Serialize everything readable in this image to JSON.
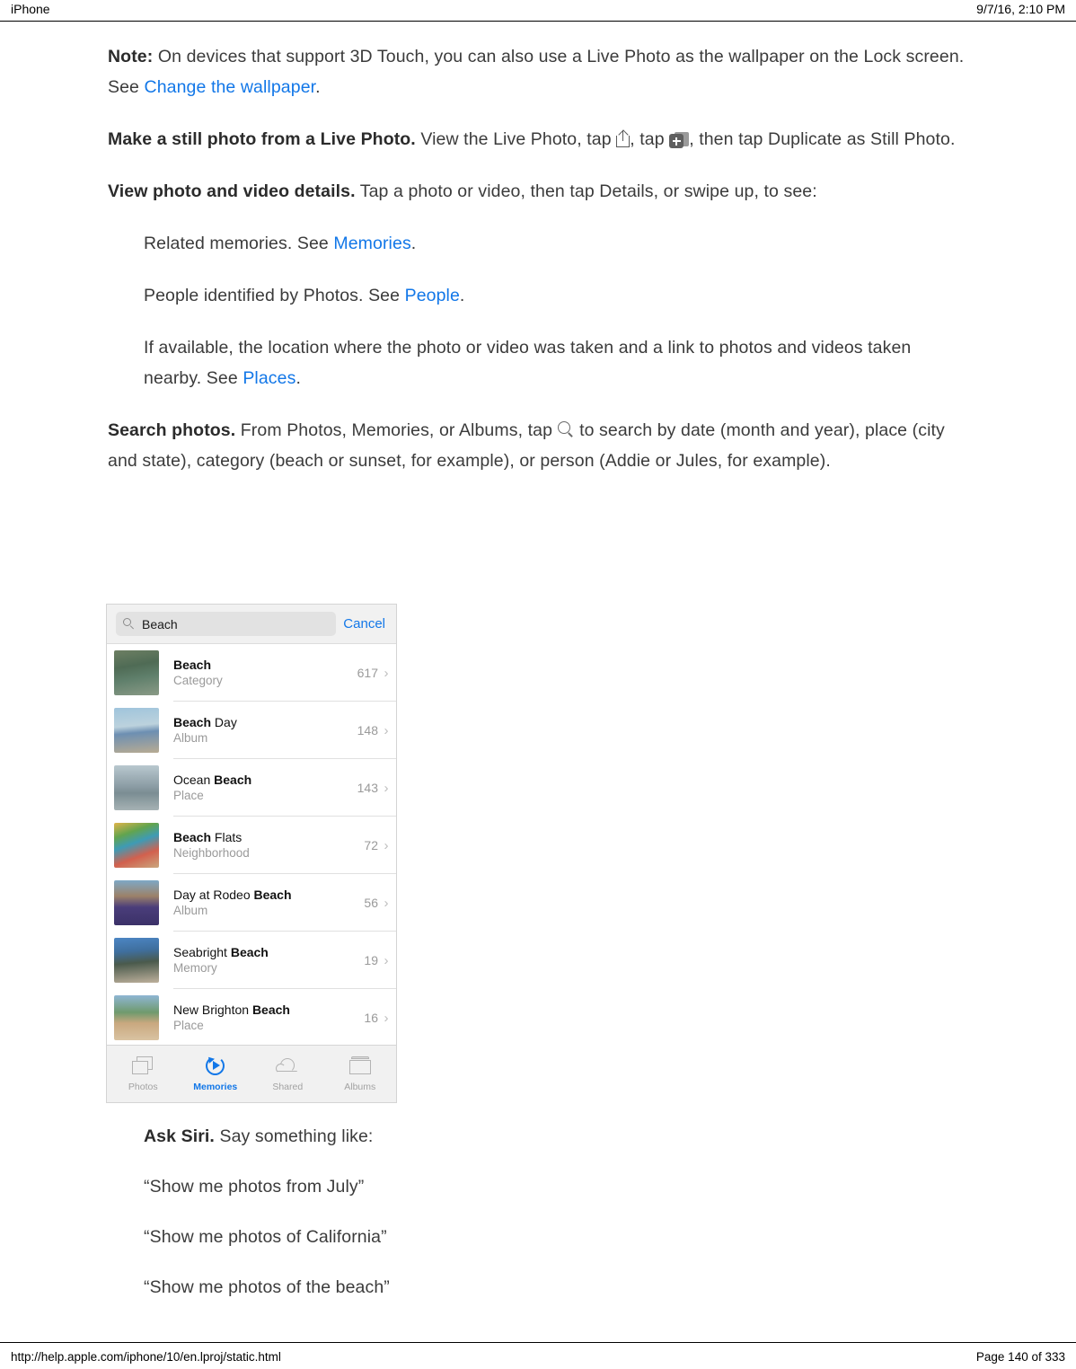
{
  "header": {
    "device_label": "iPhone",
    "timestamp": "9/7/16, 2:10 PM"
  },
  "footer": {
    "url": "http://help.apple.com/iphone/10/en.lproj/static.html",
    "page_number": "Page 140 of 333"
  },
  "colors": {
    "link": "#1277e8",
    "body_text": "#3b3b3b",
    "muted": "#9a9a9a",
    "tab_active": "#1277e8"
  },
  "content": {
    "note": {
      "lead": "Note:",
      "text_1": " On devices that support 3D Touch, you can also use a Live Photo as the wallpaper on the Lock screen. See ",
      "link": "Change the wallpaper",
      "text_2": "."
    },
    "still_photo": {
      "lead": "Make a still photo from a Live Photo.",
      "text_1": " View the Live Photo, tap ",
      "text_2": ", tap ",
      "text_3": ", then tap Duplicate as Still Photo.",
      "icon_share": "share-icon",
      "icon_duplicate": "duplicate-icon"
    },
    "details": {
      "lead": "View photo and video details.",
      "text": " Tap a photo or video, then tap Details, or swipe up, to see:"
    },
    "bullets": [
      {
        "text_1": "Related memories. See ",
        "link": "Memories",
        "text_2": "."
      },
      {
        "text_1": "People identified by Photos. See ",
        "link": "People",
        "text_2": "."
      },
      {
        "text_1": "If available, the location where the photo or video was taken and a link to photos and videos taken nearby. See ",
        "link": "Places",
        "text_2": "."
      }
    ],
    "search_photos": {
      "lead": "Search photos.",
      "text_1": " From Photos, Memories, or Albums, tap ",
      "text_2": " to search by date (month and year), place (city and state), category (beach or sunset, for example), or person (Addie or Jules, for example).",
      "icon_search": "search-icon"
    },
    "ask_siri": {
      "lead": "Ask Siri.",
      "text": " Say something like:",
      "examples": [
        "“Show me photos from July”",
        "“Show me photos of California”",
        "“Show me photos of the beach”"
      ]
    }
  },
  "screenshot": {
    "search_bar": {
      "query": "Beach",
      "cancel_label": "Cancel",
      "search_icon": "search-icon"
    },
    "results": [
      {
        "title_plain": "",
        "title_bold": "Beach",
        "title_tail": "",
        "subtitle": "Category",
        "count": "617",
        "thumb": "surf-wave-silhouette"
      },
      {
        "title_plain": "",
        "title_bold": "Beach",
        "title_tail": " Day",
        "subtitle": "Album",
        "count": "148",
        "thumb": "boy-wetsuit-beach"
      },
      {
        "title_plain": "Ocean ",
        "title_bold": "Beach",
        "title_tail": "",
        "subtitle": "Place",
        "count": "143",
        "thumb": "adult-child-shoreline"
      },
      {
        "title_plain": "",
        "title_bold": "Beach",
        "title_tail": " Flats",
        "subtitle": "Neighborhood",
        "count": "72",
        "thumb": "colorful-mural-crowd"
      },
      {
        "title_plain": "Day at Rodeo ",
        "title_bold": "Beach",
        "title_tail": "",
        "subtitle": "Album",
        "count": "56",
        "thumb": "girl-purple-jacket"
      },
      {
        "title_plain": "Seabright ",
        "title_bold": "Beach",
        "title_tail": "",
        "subtitle": "Memory",
        "count": "19",
        "thumb": "woman-lighthouse"
      },
      {
        "title_plain": "New Brighton ",
        "title_bold": "Beach",
        "title_tail": "",
        "subtitle": "Place",
        "count": "16",
        "thumb": "family-playing-sand"
      }
    ],
    "tabs": [
      {
        "label": "Photos",
        "icon": "photos-icon",
        "active": false
      },
      {
        "label": "Memories",
        "icon": "memories-icon",
        "active": true
      },
      {
        "label": "Shared",
        "icon": "cloud-icon",
        "active": false
      },
      {
        "label": "Albums",
        "icon": "albums-icon",
        "active": false
      }
    ]
  }
}
